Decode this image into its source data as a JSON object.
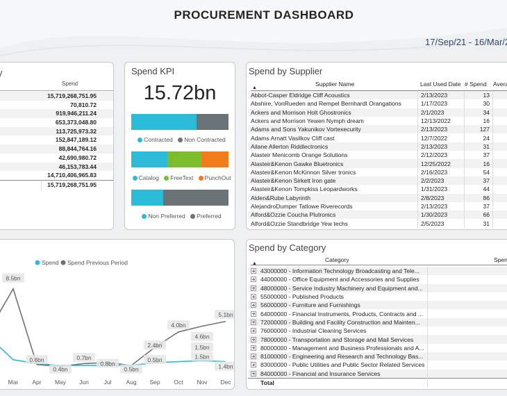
{
  "header": {
    "title": "PROCUREMENT DASHBOARD",
    "date_range": "17/Sep/21 - 16/Mar/2"
  },
  "left_card": {
    "title": "y",
    "column": "Spend",
    "values": [
      "15,719,268,751.95",
      "70,810.72",
      "919,946,211.24",
      "653,373,048.80",
      "113,725,973.32",
      "152,847,189.12",
      "88,844,764.16",
      "42,690,980.72",
      "46,153,783.44",
      "14,710,406,965.83"
    ],
    "partial_label": "a",
    "total": "15,719,268,751.95"
  },
  "kpi": {
    "title": "Spend KPI",
    "value": "15.72bn",
    "bar1": {
      "fractions": [
        0.67,
        0.33
      ],
      "colors": [
        "#2bbbd8",
        "#6b7379"
      ],
      "legend": [
        "Contracted",
        "Non Contracted"
      ]
    },
    "bar2": {
      "fractions": [
        0.37,
        0.35,
        0.28
      ],
      "colors": [
        "#2bbbd8",
        "#7bbd2c",
        "#f07d1a"
      ],
      "legend": [
        "Catalog",
        "FreeText",
        "PunchOut"
      ]
    },
    "bar3": {
      "fractions": [
        0.33,
        0.67
      ],
      "colors": [
        "#2bbbd8",
        "#6b7379"
      ],
      "legend": [
        "Non Preferred",
        "Preferred"
      ]
    }
  },
  "supplier": {
    "title": "Spend by Supplier",
    "columns": [
      "Supplier Name",
      "Last Used Date",
      "# Spend",
      "Averag"
    ],
    "rows": [
      [
        "Abbot-Casper Eldridge Cliff Acoustics",
        "2/13/2023",
        "13"
      ],
      [
        "Abshire, VonRueden and Rempel Bernhardt Orangations",
        "1/17/2023",
        "30"
      ],
      [
        "Ackers and Morrison Holt Ghostronics",
        "2/1/2023",
        "34"
      ],
      [
        "Ackers and Morrison Yewen Nymph dream",
        "12/13/2022",
        "16"
      ],
      [
        "Adams and Sons Yakunikov Vortexecurity",
        "2/13/2023",
        "127"
      ],
      [
        "Adams Arnatt Vasilkov Cliff cast",
        "12/7/2022",
        "24"
      ],
      [
        "Ailane Allerton Riddlectronics",
        "2/13/2023",
        "31"
      ],
      [
        "Alasteir Menicomb Orange Solutions",
        "2/12/2023",
        "37"
      ],
      [
        "Alasteir&Kenon Gawke Bluetronics",
        "12/25/2022",
        "16"
      ],
      [
        "Alasteir&Kenon McKinnon Silver tronics",
        "2/16/2023",
        "54"
      ],
      [
        "Alasteir&Kenon Sirkett Iron gate",
        "2/2/2023",
        "37"
      ],
      [
        "Alasteir&Kenon Tompkiss Leopardworks",
        "1/31/2023",
        "44"
      ],
      [
        "Alden&Rube Labyrinth",
        "2/8/2023",
        "86"
      ],
      [
        "AlejandroDumper Tatlowe Riverecords",
        "2/13/2023",
        "37"
      ],
      [
        "Alford&Ozzie Coucha Plutronics",
        "1/30/2023",
        "66"
      ],
      [
        "Alford&Ozzie Standbridge Yew techs",
        "2/5/2023",
        "31"
      ]
    ]
  },
  "line_chart": {
    "legend": [
      "Spend",
      "Spend Previous Period"
    ],
    "colors": {
      "spend": "#2bbbd8",
      "previous": "#6b7379"
    }
  },
  "chart_data": {
    "type": "line",
    "categories": [
      "Mar",
      "Apr",
      "May",
      "Jun",
      "Jul",
      "Aug",
      "Sep",
      "Oct",
      "Nov",
      "Dec"
    ],
    "series": [
      {
        "name": "Spend",
        "values": [
          1.1,
          0.7,
          0.5,
          0.5,
          0.5,
          0.5,
          0.8,
          0.9,
          1.0,
          0.9
        ]
      },
      {
        "name": "Spend Previous Period",
        "values": [
          8.5,
          0.6,
          0.4,
          0.7,
          0.8,
          0.5,
          2.4,
          4.0,
          4.6,
          5.1
        ]
      }
    ],
    "labels": [
      "8.5bn",
      "0.6bn",
      "0.4bn",
      "0.7bn",
      "0.8bn",
      "0.5bn",
      "2.4bn",
      "0.5bn",
      "4.0bn",
      "4.6bn",
      "1.5bn",
      "1.5bn",
      "5.1bn",
      "1.4bn"
    ],
    "ylim": [
      0,
      10
    ],
    "grid": false,
    "legend_position": "top"
  },
  "category": {
    "title": "Spend by Category",
    "columns": [
      "Category",
      "Spend"
    ],
    "rows": [
      "43000000 - Information Technology Broadcasting and Tele...",
      "44000000 - Office Equipment and Accessories and Supplies",
      "48000000 - Service Industry Machinery and Equipment and...",
      "55000000 - Published Products",
      "56000000 - Furniture and Furnishings",
      "64000000 - Financial Instruments, Products, Contracts and ...",
      "72000000 - Building and Facility Construction and Mainten...",
      "76000000 - Industrial Cleaning Services",
      "78000000 - Transportation and Storage and Mail Services",
      "80000000 - Management and Business Professionals and A...",
      "81000000 - Engineering and Research and Technology Bas...",
      "83000000 - Public Utilities and Public Sector Related Services",
      "84000000 - Financial and Insurance Services"
    ],
    "total": "Total"
  }
}
